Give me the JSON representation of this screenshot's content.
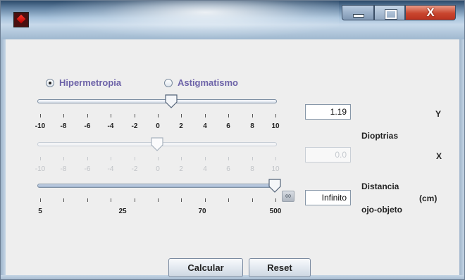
{
  "window": {
    "minimize_icon": "minimize-icon",
    "maximize_icon": "maximize-icon",
    "close_label": "X"
  },
  "mode": {
    "options": [
      {
        "label": "Hipermetropia",
        "selected": true
      },
      {
        "label": "Astigmatismo",
        "selected": false
      }
    ]
  },
  "slider_y": {
    "ticks": [
      "-10",
      "-8",
      "-6",
      "-4",
      "-2",
      "0",
      "2",
      "4",
      "6",
      "8",
      "10"
    ],
    "value": 1.19,
    "enabled": true
  },
  "slider_x": {
    "ticks": [
      "-10",
      "-8",
      "-6",
      "-4",
      "-2",
      "0",
      "2",
      "4",
      "6",
      "8",
      "10"
    ],
    "value": 0.0,
    "enabled": false
  },
  "slider_distance": {
    "ticks": [
      "5",
      "25",
      "70",
      "500"
    ],
    "value_label": "Infinito",
    "at_max": true,
    "infinity_button": "∞"
  },
  "fields": {
    "y_value": "1.19",
    "x_value": "0.0",
    "distance_value": "Infinito"
  },
  "labels": {
    "y": "Y",
    "x": "X",
    "dioptrias": "Dioptrias",
    "distancia_line1": "Distancia",
    "distancia_line2": "ojo-objeto",
    "unit": "(cm)"
  },
  "buttons": {
    "calcular": "Calcular",
    "reset": "Reset"
  },
  "colors": {
    "radio_label": "#6d63a8",
    "close_button": "#c9452e"
  }
}
